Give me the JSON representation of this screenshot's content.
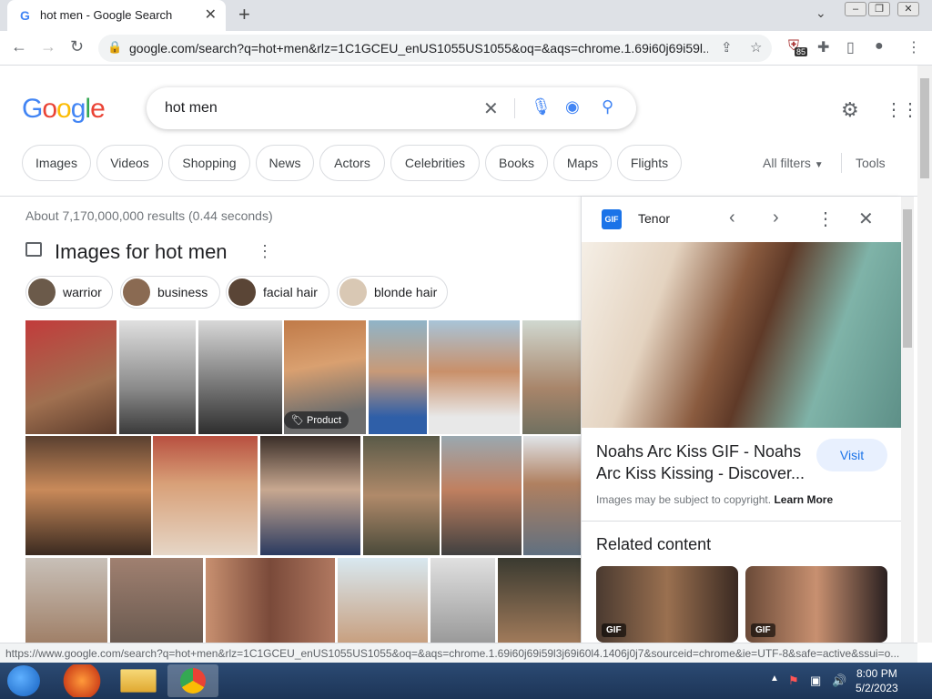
{
  "browser": {
    "tab_title": "hot men - Google Search",
    "tab_favicon": "G",
    "url": "google.com/search?q=hot+men&rlz=1C1GCEU_enUS1055US1055&oq=&aqs=chrome.1.69i60j69i59l...",
    "extension_badge": "85"
  },
  "search": {
    "logo": "Google",
    "query": "hot men",
    "filters": [
      "Images",
      "Videos",
      "Shopping",
      "News",
      "Actors",
      "Celebrities",
      "Books",
      "Maps",
      "Flights"
    ],
    "all_filters": "All filters",
    "tools": "Tools"
  },
  "results": {
    "count_text": "About 7,170,000,000 results (0.44 seconds)",
    "images_title": "Images for hot men",
    "refine_chips": [
      "warrior",
      "business",
      "facial hair",
      "blonde hair"
    ],
    "product_badge": "Product"
  },
  "panel": {
    "source_icon": "GIF",
    "source": "Tenor",
    "title": "Noahs Arc Kiss GIF - Noahs Arc Kiss Kissing - Discover...",
    "visit": "Visit",
    "copyright": "Images may be subject to copyright. ",
    "learn_more": "Learn More",
    "related_heading": "Related content",
    "related_badges": [
      "GIF",
      "GIF"
    ]
  },
  "status_bar": "https://www.google.com/search?q=hot+men&rlz=1C1GCEU_enUS1055US1055&oq=&aqs=chrome.1.69i60j69i59l3j69i60l4.1406j0j7&sourceid=chrome&ie=UTF-8&safe=active&ssui=o...",
  "taskbar": {
    "time": "8:00 PM",
    "date": "5/2/2023"
  },
  "colors": {
    "accent": "#1a73e8",
    "google_blue": "#4285f4",
    "google_red": "#ea4335",
    "google_yellow": "#fbbc05",
    "google_green": "#34a853"
  }
}
